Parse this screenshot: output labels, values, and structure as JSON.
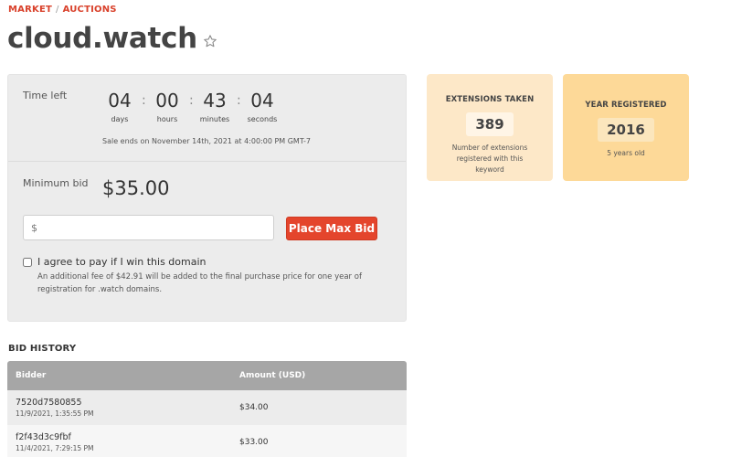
{
  "breadcrumb": {
    "items": [
      "MARKET",
      "AUCTIONS"
    ],
    "separator": "/"
  },
  "page": {
    "title": "cloud.watch",
    "favorite_icon": "star-outline-icon"
  },
  "auction": {
    "time_left_label": "Time left",
    "countdown": [
      {
        "value": "04",
        "unit": "days"
      },
      {
        "value": "00",
        "unit": "hours"
      },
      {
        "value": "43",
        "unit": "minutes"
      },
      {
        "value": "04",
        "unit": "seconds"
      }
    ],
    "sale_ends": "Sale ends on November 14th, 2021 at 4:00:00 PM GMT-7",
    "minimum_bid_label": "Minimum bid",
    "minimum_bid_value": "$35.00",
    "bid_input_placeholder": "$",
    "place_bid_label": "Place Max Bid",
    "agree_label": "I agree to pay if I win this domain",
    "fee_note": "An additional fee of $42.91 will be added to the final purchase price for one year of registration for .watch domains."
  },
  "stats": {
    "extensions": {
      "title": "EXTENSIONS TAKEN",
      "value": "389",
      "caption": "Number of extensions registered with this keyword"
    },
    "year": {
      "title": "YEAR REGISTERED",
      "value": "2016",
      "caption": "5 years old"
    }
  },
  "history": {
    "title": "BID HISTORY",
    "columns": [
      "Bidder",
      "Amount (USD)"
    ],
    "rows": [
      {
        "bidder": "7520d7580855",
        "time": "11/9/2021, 1:35:55 PM",
        "amount": "$34.00"
      },
      {
        "bidder": "f2f43d3c9fbf",
        "time": "11/4/2021, 7:29:15 PM",
        "amount": "$33.00"
      }
    ]
  },
  "colors": {
    "accent": "#d9412b",
    "button": "#e4452c",
    "card_extensions": "#fde8c8",
    "card_year": "#fdd998",
    "table_header": "#a6a6a6"
  }
}
